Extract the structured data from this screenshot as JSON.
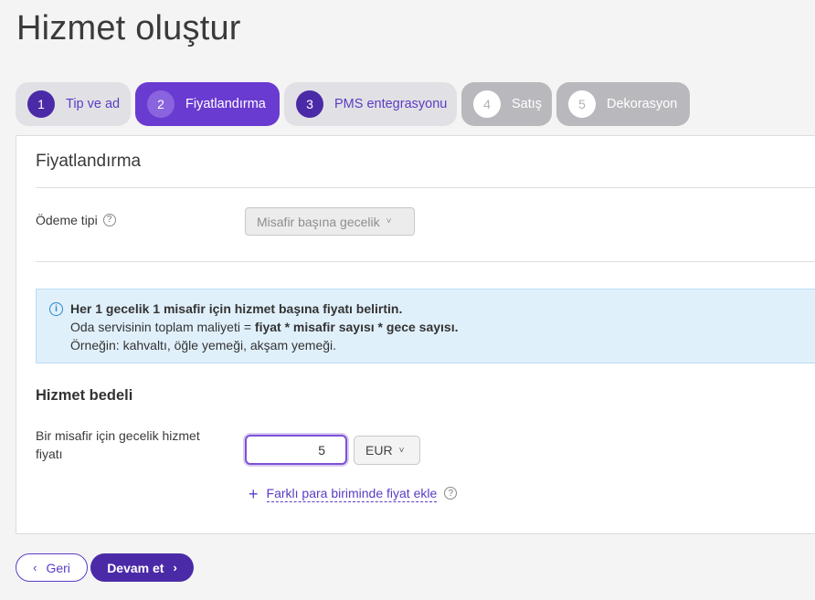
{
  "page": {
    "title": "Hizmet oluştur"
  },
  "steps": [
    {
      "num": "1",
      "label": "Tip ve ad",
      "state": "done"
    },
    {
      "num": "2",
      "label": "Fiyatlandırma",
      "state": "active"
    },
    {
      "num": "3",
      "label": "PMS entegrasyonu",
      "state": "done"
    },
    {
      "num": "4",
      "label": "Satış",
      "state": "disabled"
    },
    {
      "num": "5",
      "label": "Dekorasyon",
      "state": "disabled"
    }
  ],
  "section": {
    "title": "Fiyatlandırma"
  },
  "payment": {
    "label": "Ödeme tipi",
    "value": "Misafir başına gecelik"
  },
  "info": {
    "line1": "Her 1 gecelik 1 misafir için hizmet başına fiyatı belirtin.",
    "line2_prefix": "Oda servisinin toplam maliyeti = ",
    "line2_bold": "fiyat * misafir sayısı * gece sayısı.",
    "line3": "Örneğin: kahvaltı, öğle yemeği, akşam yemeği."
  },
  "service_fee": {
    "title": "Hizmet bedeli",
    "price_label_line1": "Bir misafir için gecelik hizmet",
    "price_label_line2": "fiyatı",
    "price_value": "5",
    "currency": "EUR",
    "add_currency": "Farklı para biriminde fiyat ekle"
  },
  "buttons": {
    "back": "Geri",
    "next": "Devam et"
  },
  "colors": {
    "primary": "#4b2aa8",
    "active_step": "#6a3bd0",
    "info_bg": "#e0f0fb"
  }
}
